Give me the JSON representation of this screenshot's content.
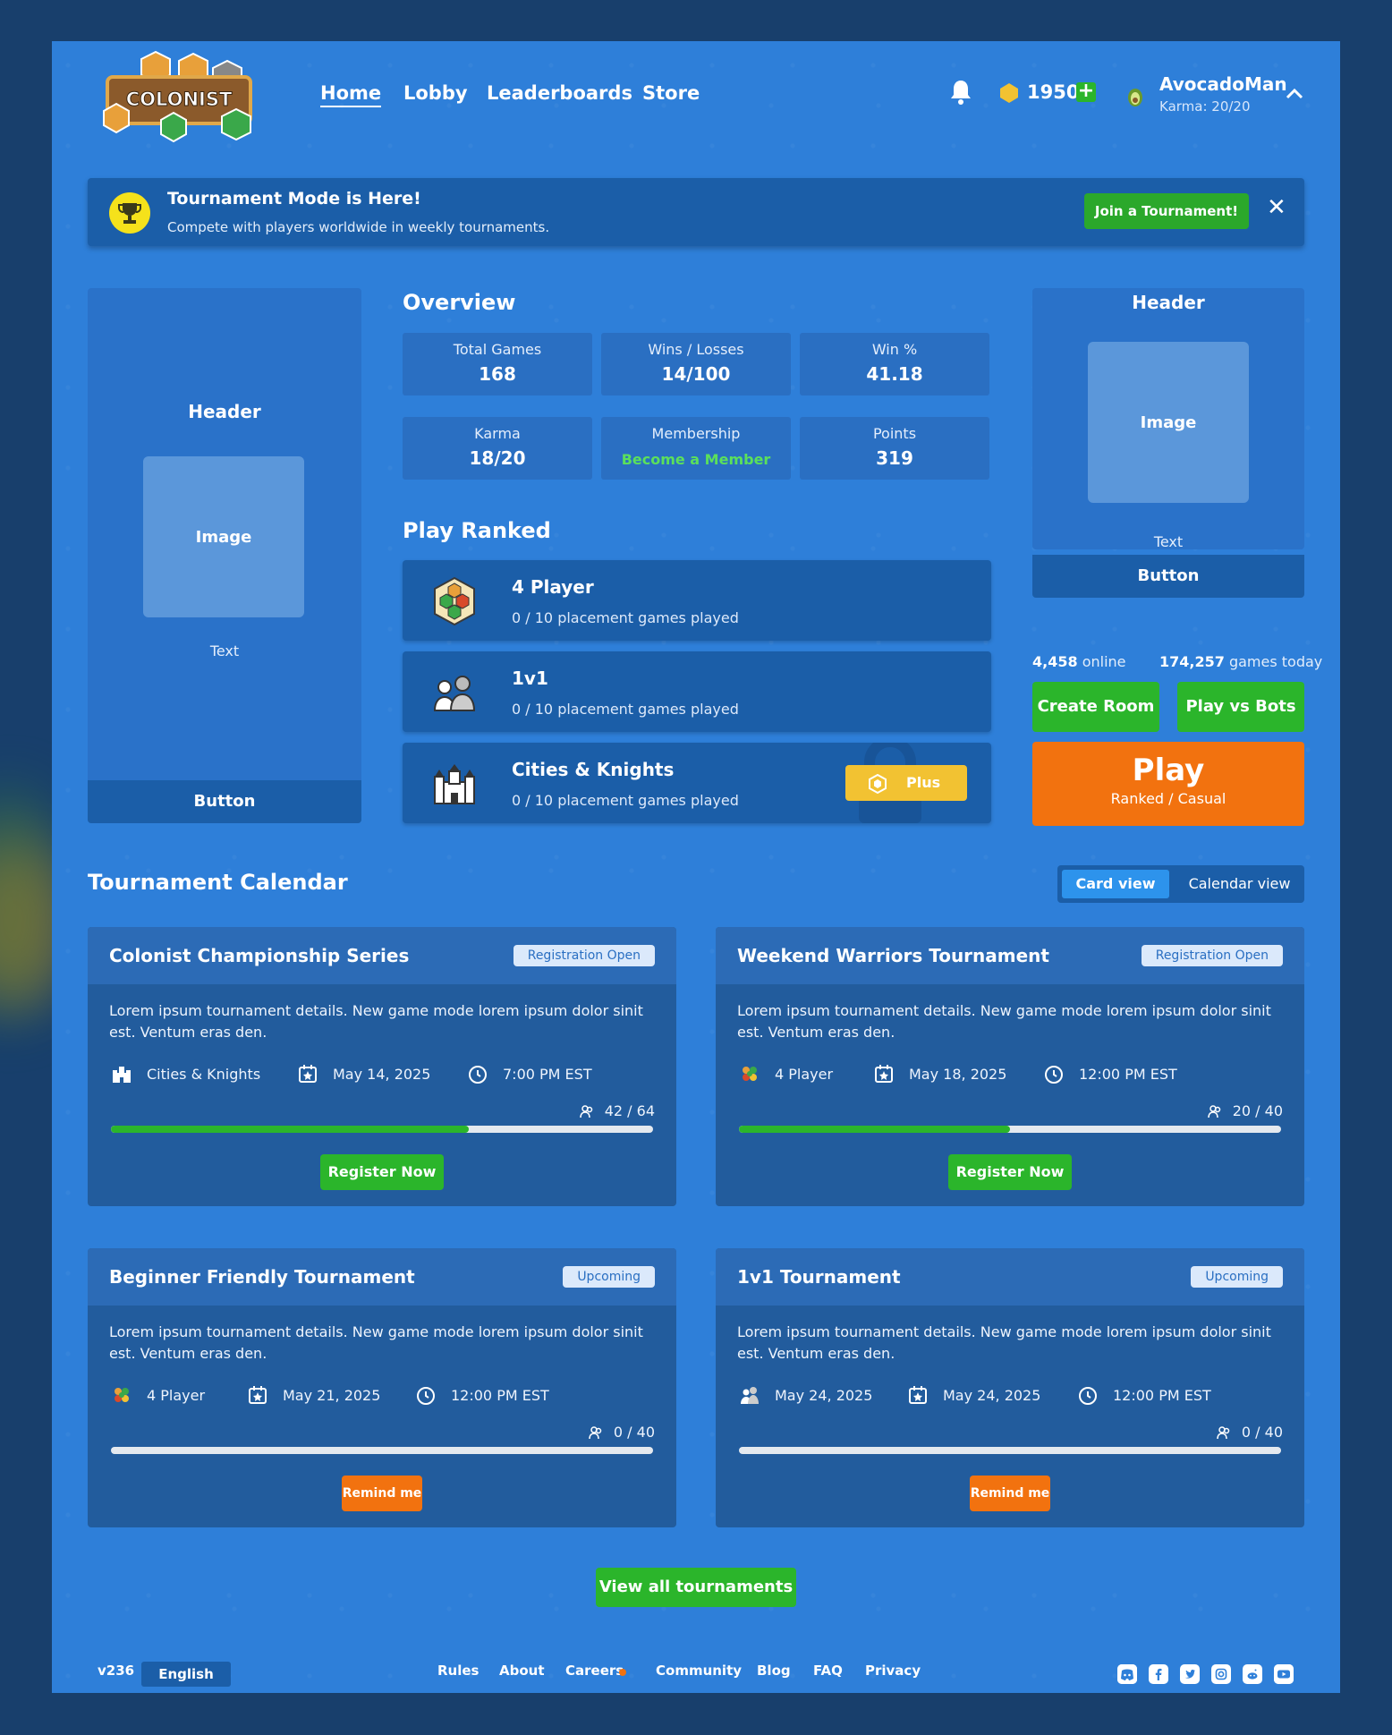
{
  "brand": {
    "logo_text": "COLONIST"
  },
  "nav": {
    "home": "Home",
    "lobby": "Lobby",
    "leaderboards": "Leaderboards",
    "store": "Store"
  },
  "user": {
    "coins": "1950",
    "plus_icon": "+",
    "username": "AvocadoMan",
    "karma": "Karma: 20/20"
  },
  "banner": {
    "title": "Tournament Mode is Here!",
    "subtitle": "Compete with players worldwide in weekly tournaments.",
    "cta": "Join a Tournament!",
    "close": "✕"
  },
  "left_promo": {
    "header": "Header",
    "image": "Image",
    "text": "Text",
    "button": "Button"
  },
  "right_promo": {
    "header": "Header",
    "image": "Image",
    "text": "Text",
    "button": "Button"
  },
  "overview": {
    "title": "Overview",
    "stats": [
      {
        "label": "Total Games",
        "value": "168"
      },
      {
        "label": "Wins / Losses",
        "value": "14/100"
      },
      {
        "label": "Win %",
        "value": "41.18"
      },
      {
        "label": "Karma",
        "value": "18/20"
      },
      {
        "label": "Membership",
        "value": "Become a Member"
      },
      {
        "label": "Points",
        "value": "319"
      }
    ]
  },
  "play_ranked": {
    "title": "Play Ranked",
    "modes": [
      {
        "title": "4 Player",
        "subtitle": "0 / 10 placement games played",
        "icon": "hex-board-icon"
      },
      {
        "title": "1v1",
        "subtitle": "0 / 10 placement games played",
        "icon": "duel-players-icon"
      },
      {
        "title": "Cities & Knights",
        "subtitle": "0 / 10 placement games played",
        "icon": "castle-icon",
        "badge": "Plus"
      }
    ]
  },
  "status": {
    "online_count": "4,458",
    "online_label": "online",
    "games_count": "174,257",
    "games_label": "games today"
  },
  "actions": {
    "create_room": "Create Room",
    "play_bots": "Play vs Bots",
    "play": "Play",
    "play_sub": "Ranked / Casual"
  },
  "calendar": {
    "title": "Tournament Calendar",
    "card_view": "Card view",
    "calendar_view": "Calendar view",
    "tournaments": [
      {
        "name": "Colonist Championship Series",
        "status": "Registration Open",
        "description": "Lorem ipsum tournament details. New game mode lorem ipsum dolor sinit est. Ventum eras den.",
        "mode": "Cities & Knights",
        "date": "May 14, 2025",
        "time": "7:00 PM EST",
        "registered": "42 / 64",
        "fill_fraction": 0.66,
        "action": "Register Now"
      },
      {
        "name": "Weekend Warriors Tournament",
        "status": "Registration Open",
        "description": "Lorem ipsum tournament details. New game mode lorem ipsum dolor sinit est. Ventum eras den.",
        "mode": "4 Player",
        "date": "May 18, 2025",
        "time": "12:00 PM EST",
        "registered": "20 / 40",
        "fill_fraction": 0.5,
        "action": "Register Now"
      },
      {
        "name": "Beginner Friendly Tournament",
        "status": "Upcoming",
        "description": "Lorem ipsum tournament details. New game mode lorem ipsum dolor sinit est. Ventum eras den.",
        "mode": "4 Player",
        "date": "May 21, 2025",
        "time": "12:00 PM EST",
        "registered": "0 / 40",
        "fill_fraction": 0,
        "action": "Remind me"
      },
      {
        "name": "1v1 Tournament",
        "status": "Upcoming",
        "description": "Lorem ipsum tournament details. New game mode lorem ipsum dolor sinit est. Ventum eras den.",
        "mode": "May 24, 2025",
        "date": "May 24, 2025",
        "time": "12:00 PM EST",
        "registered": "0 / 40",
        "fill_fraction": 0,
        "action": "Remind me"
      }
    ],
    "view_all": "View all tournaments"
  },
  "footer": {
    "version": "v236",
    "language": "English",
    "links": [
      "Rules",
      "About",
      "Careers",
      "Community",
      "Blog",
      "FAQ",
      "Privacy"
    ],
    "social_icons": [
      "discord-icon",
      "facebook-icon",
      "twitter-icon",
      "instagram-icon",
      "reddit-icon",
      "youtube-icon"
    ]
  },
  "colors": {
    "page_bg": "#2e7fd9",
    "accent_green": "#2bb52b",
    "accent_orange": "#f2720f",
    "plus_gold": "#f2c232"
  }
}
